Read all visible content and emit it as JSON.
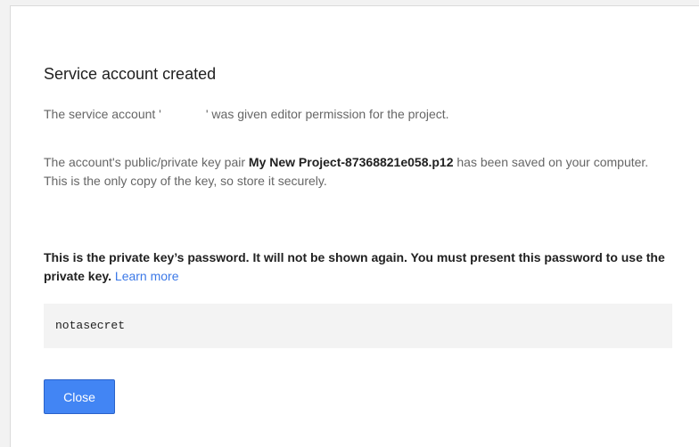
{
  "dialog": {
    "title": "Service account created",
    "message1": {
      "before": "The service account '",
      "after": "' was given editor permission for the project."
    },
    "message2": {
      "before": "The account's public/private key pair ",
      "key_file": "My New Project-87368821e058.p12",
      "after": " has been saved on your computer. This is the only copy of the key, so store it securely."
    },
    "message3": {
      "text": "This is the private key’s password. It will not be shown again. You must present this password to use the private key. ",
      "learn_more": "Learn more"
    },
    "password": "notasecret",
    "close_label": "Close"
  },
  "colors": {
    "button_bg": "#4285f4",
    "link": "#3b78e7",
    "password_box_bg": "#f3f3f3"
  }
}
